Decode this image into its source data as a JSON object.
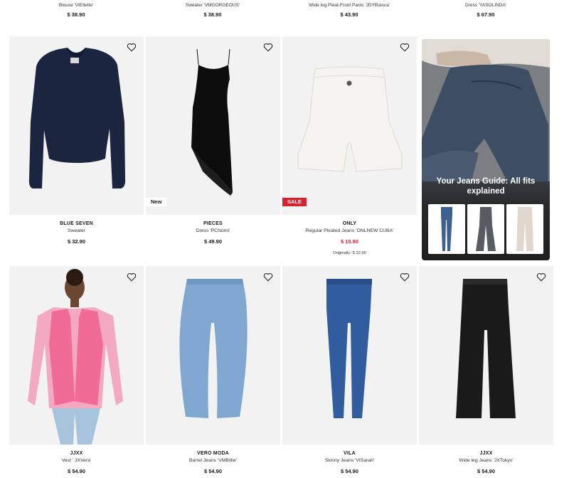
{
  "top_row": [
    {
      "name": "Blouse 'VIEllette'",
      "price": "$ 38.90"
    },
    {
      "name": "Sweater 'VMGORGEOUS'",
      "price": "$ 38.90"
    },
    {
      "name": "Wide leg Pleat-Front Pants 'JDYBianca'",
      "price": "$ 43.90"
    },
    {
      "name": "Dress 'YASOLINDA'",
      "price": "$ 67.90"
    }
  ],
  "row1": [
    {
      "brand": "BLUE SEVEN",
      "name": "Sweater",
      "price": "$ 32.90"
    },
    {
      "brand": "PIECES",
      "name": "Dress 'PCNomi'",
      "price": "$ 49.90",
      "badge": "New"
    },
    {
      "brand": "ONLY",
      "name": "Regular Pleated Jeans 'ONLNEW CUBA'",
      "price": "$ 15.90",
      "badge": "SALE",
      "original": "Originally: $ 32.90"
    }
  ],
  "promo": {
    "title": "Your Jeans Guide: All fits explained"
  },
  "row2": [
    {
      "brand": "JJXX",
      "name": "Vest ' JXVera'",
      "price": "$ 54.90"
    },
    {
      "brand": "VERO MODA",
      "name": "Barrel Jeans 'VMBillie'",
      "price": "$ 54.90"
    },
    {
      "brand": "VILA",
      "name": "Skinny Jeans 'VISarah'",
      "price": "$ 54.90"
    },
    {
      "brand": "JJXX",
      "name": "Wide leg Jeans 'JXTokyo'",
      "price": "$ 54.90"
    }
  ],
  "colors": {
    "sale": "#d8232f",
    "image_bg": "#f2f2f2",
    "text": "#1a1a1a"
  }
}
